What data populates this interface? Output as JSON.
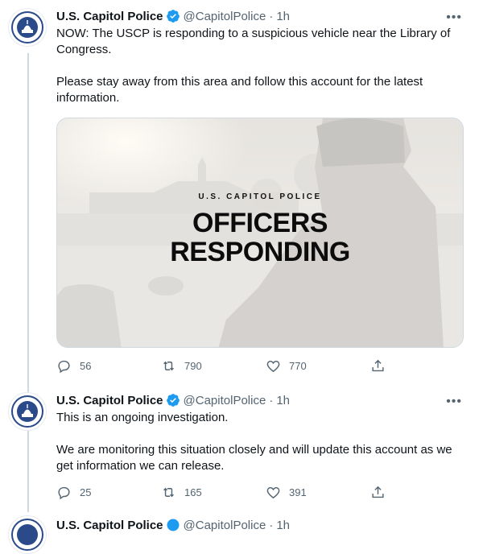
{
  "tweets": [
    {
      "name": "U.S. Capitol Police",
      "handle": "@CapitolPolice",
      "time": "1h",
      "more": "•••",
      "paragraphs": [
        "NOW: The USCP is responding to a suspicious vehicle near the Library of Congress.",
        "Please stay away from this area and follow this account for the latest information."
      ],
      "media": {
        "small_title": "U.S. CAPITOL POLICE",
        "big_title_line1": "OFFICERS",
        "big_title_line2": "RESPONDING"
      },
      "replies": "56",
      "retweets": "790",
      "likes": "770"
    },
    {
      "name": "U.S. Capitol Police",
      "handle": "@CapitolPolice",
      "time": "1h",
      "more": "•••",
      "paragraphs": [
        "This is an ongoing investigation.",
        "We are monitoring this situation closely and will update this account as we get information we can release."
      ],
      "replies": "25",
      "retweets": "165",
      "likes": "391"
    }
  ],
  "partial_header": {
    "name": "U.S. Capitol Police",
    "handle": "@CapitolPolice",
    "time": "1h"
  },
  "colors": {
    "verified": "#1d9bf0",
    "secondary_text": "#536471",
    "thread_line": "#cfd9de",
    "seal_blue": "#2a4a8a"
  },
  "icons": [
    "verified-badge-icon",
    "more-icon",
    "reply-icon",
    "retweet-icon",
    "like-icon",
    "share-icon"
  ]
}
